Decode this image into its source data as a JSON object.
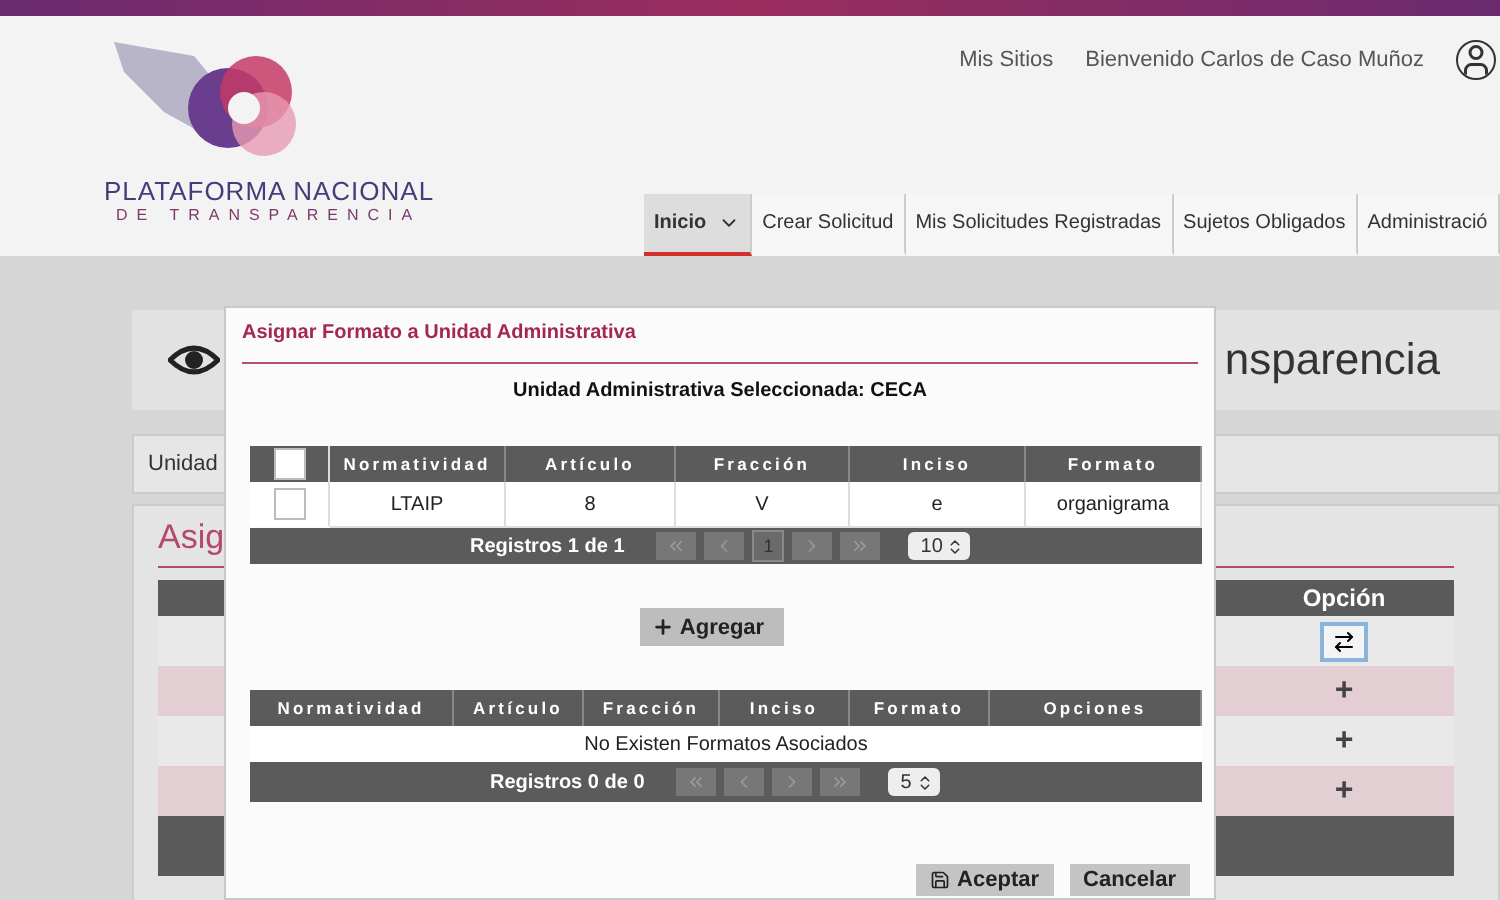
{
  "header": {
    "logo": {
      "line1": "PLATAFORMA NACIONAL",
      "line2": "DE TRANSPARENCIA"
    },
    "links": [
      "Mis Sitios",
      "Bienvenido Carlos de Caso Muñoz"
    ],
    "nav": [
      {
        "label": "Inicio",
        "selected": true,
        "dropdown": true
      },
      {
        "label": "Crear Solicitud",
        "selected": false,
        "dropdown": false
      },
      {
        "label": "Mis Solicitudes Registradas",
        "selected": false,
        "dropdown": false
      },
      {
        "label": "Sujetos Obligados",
        "selected": false,
        "dropdown": false
      },
      {
        "label": "Administració",
        "selected": false,
        "dropdown": false
      }
    ]
  },
  "page": {
    "title_fragment": "nsparencia",
    "breadcrumb_fragment": "Unidad",
    "heading_fragment": "Asig",
    "table": {
      "column": "Opción",
      "rows": [
        {
          "kind": "assign"
        },
        {
          "kind": "add",
          "symbol": "+"
        },
        {
          "kind": "add",
          "symbol": "+"
        },
        {
          "kind": "add",
          "symbol": "+"
        }
      ]
    }
  },
  "modal": {
    "title": "Asignar Formato a Unidad Administrativa",
    "selected_unit": "Unidad Administrativa Seleccionada: CECA",
    "available": {
      "columns": [
        "Normatividad",
        "Artículo",
        "Fracción",
        "Inciso",
        "Formato"
      ],
      "header_checked": false,
      "rows": [
        {
          "checked": false,
          "cells": [
            "LTAIP",
            "8",
            "V",
            "e",
            "organigrama"
          ]
        }
      ],
      "footer": "Registros 1 de 1",
      "page": "1",
      "page_size": "10"
    },
    "add_button": "Agregar",
    "assigned": {
      "columns": [
        "Normatividad",
        "Artículo",
        "Fracción",
        "Inciso",
        "Formato",
        "Opciones"
      ],
      "empty": "No Existen Formatos Asociados",
      "footer": "Registros 0 de 0",
      "page_size": "5"
    },
    "buttons": [
      {
        "label": "Aceptar",
        "kind": "accept"
      },
      {
        "label": "Cancelar",
        "kind": "cancel"
      }
    ]
  }
}
